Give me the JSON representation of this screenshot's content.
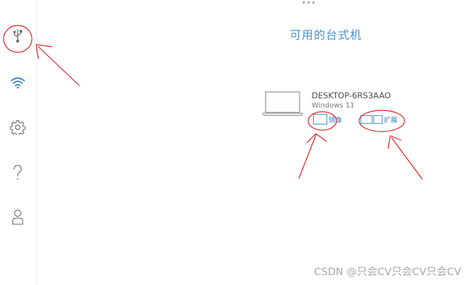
{
  "drag_handle": "•••",
  "sidebar": {
    "items": [
      {
        "icon": "usb-icon",
        "active": true
      },
      {
        "icon": "wifi-icon",
        "active": false
      },
      {
        "icon": "gear-icon",
        "active": false
      },
      {
        "icon": "help-icon",
        "active": false
      },
      {
        "icon": "user-icon",
        "active": false
      }
    ]
  },
  "main": {
    "title": "可用的台式机",
    "device": {
      "name": "DESKTOP-6RS3AAO",
      "os": "Windows 11",
      "mirror_label": "镜像",
      "extend_label": "扩展"
    }
  },
  "watermark": "CSDN @只会CV只会CV只会CV",
  "colors": {
    "accent": "#4a90d0",
    "annotation": "#e02020",
    "icon_gray": "#7a7a7a"
  }
}
